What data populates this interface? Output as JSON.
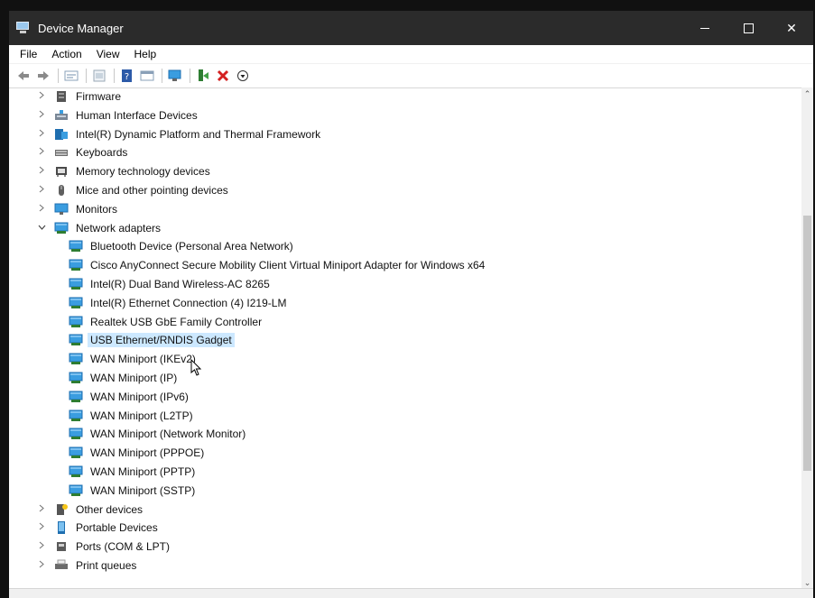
{
  "window": {
    "title": "Device Manager",
    "controls": {
      "minimize": "minimize",
      "maximize": "maximize",
      "close": "✕"
    }
  },
  "menu": [
    "File",
    "Action",
    "View",
    "Help"
  ],
  "toolbar_icons": [
    "back-icon",
    "forward-icon",
    "properties-icon",
    "view-icon",
    "help-icon",
    "console-icon",
    "scan-hardware-icon",
    "update-driver-icon",
    "uninstall-icon",
    "disable-icon"
  ],
  "colors": {
    "titlebar": "#2b2b2b",
    "selection": "#cce8ff",
    "network_icon": "#3a9de0",
    "delete_red": "#d42020"
  },
  "tree": [
    {
      "label": "Firmware",
      "expand": ">",
      "icon": "firmware-icon"
    },
    {
      "label": "Human Interface Devices",
      "expand": ">",
      "icon": "hid-icon"
    },
    {
      "label": "Intel(R) Dynamic Platform and Thermal Framework",
      "expand": ">",
      "icon": "intel-dptf-icon"
    },
    {
      "label": "Keyboards",
      "expand": ">",
      "icon": "keyboard-icon"
    },
    {
      "label": "Memory technology devices",
      "expand": ">",
      "icon": "memory-icon"
    },
    {
      "label": "Mice and other pointing devices",
      "expand": ">",
      "icon": "mouse-icon"
    },
    {
      "label": "Monitors",
      "expand": ">",
      "icon": "monitor-icon"
    },
    {
      "label": "Network adapters",
      "expand": "v",
      "icon": "network-adapter-icon"
    },
    {
      "label": "Bluetooth Device (Personal Area Network)",
      "icon": "network-adapter-icon"
    },
    {
      "label": "Cisco AnyConnect Secure Mobility Client Virtual Miniport Adapter for Windows x64",
      "icon": "network-adapter-icon"
    },
    {
      "label": "Intel(R) Dual Band Wireless-AC 8265",
      "icon": "network-adapter-icon"
    },
    {
      "label": "Intel(R) Ethernet Connection (4) I219-LM",
      "icon": "network-adapter-icon"
    },
    {
      "label": "Realtek USB GbE Family Controller",
      "icon": "network-adapter-icon"
    },
    {
      "label": "USB Ethernet/RNDIS Gadget",
      "icon": "network-adapter-icon"
    },
    {
      "label": "WAN Miniport (IKEv2)",
      "icon": "network-adapter-icon"
    },
    {
      "label": "WAN Miniport (IP)",
      "icon": "network-adapter-icon"
    },
    {
      "label": "WAN Miniport (IPv6)",
      "icon": "network-adapter-icon"
    },
    {
      "label": "WAN Miniport (L2TP)",
      "icon": "network-adapter-icon"
    },
    {
      "label": "WAN Miniport (Network Monitor)",
      "icon": "network-adapter-icon"
    },
    {
      "label": "WAN Miniport (PPPOE)",
      "icon": "network-adapter-icon"
    },
    {
      "label": "WAN Miniport (PPTP)",
      "icon": "network-adapter-icon"
    },
    {
      "label": "WAN Miniport (SSTP)",
      "icon": "network-adapter-icon"
    },
    {
      "label": "Other devices",
      "expand": ">",
      "icon": "other-devices-icon"
    },
    {
      "label": "Portable Devices",
      "expand": ">",
      "icon": "portable-device-icon"
    },
    {
      "label": "Ports (COM & LPT)",
      "expand": ">",
      "icon": "port-icon"
    },
    {
      "label": "Print queues",
      "expand": ">",
      "icon": "printer-icon"
    }
  ],
  "selected": "USB Ethernet/RNDIS Gadget"
}
